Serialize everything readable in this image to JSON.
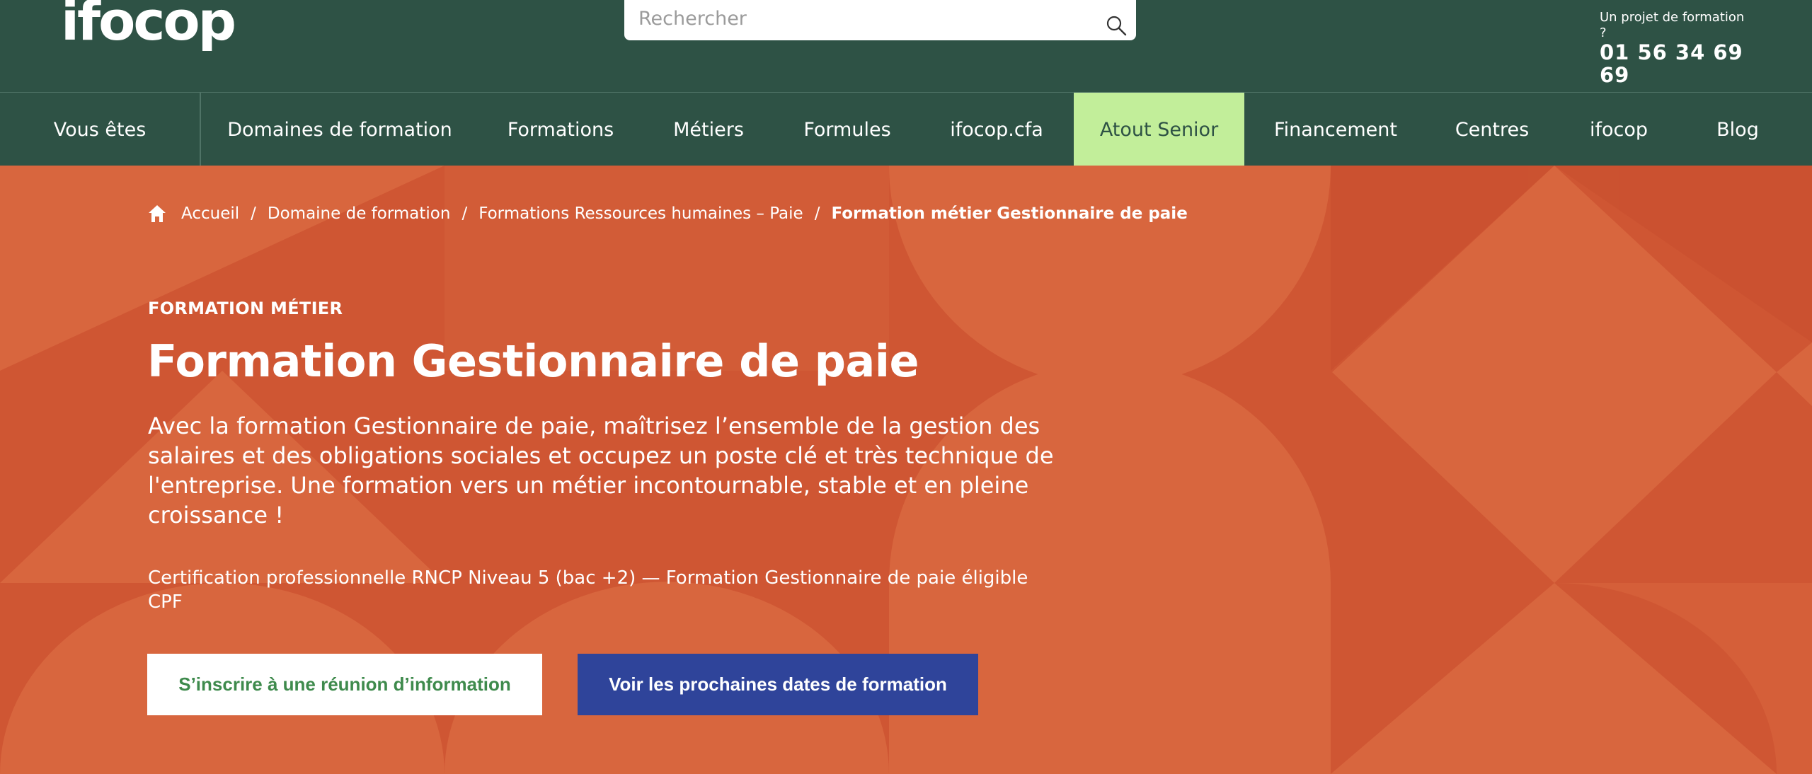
{
  "header": {
    "logo_text": "ifocop",
    "search_placeholder": "Rechercher",
    "contact_label": "Un projet de formation ?",
    "contact_phone": "01 56 34 69 69"
  },
  "nav": {
    "items": [
      {
        "label": "Vous êtes"
      },
      {
        "label": "Domaines de formation"
      },
      {
        "label": "Formations"
      },
      {
        "label": "Métiers"
      },
      {
        "label": "Formules"
      },
      {
        "label": "ifocop.cfa"
      },
      {
        "label": "Atout Senior"
      },
      {
        "label": "Financement"
      },
      {
        "label": "Centres"
      },
      {
        "label": "ifocop"
      },
      {
        "label": "Blog"
      }
    ]
  },
  "breadcrumb": {
    "items": [
      {
        "label": "Accueil"
      },
      {
        "label": "Domaine de formation"
      },
      {
        "label": "Formations Ressources humaines – Paie"
      },
      {
        "label": "Formation métier Gestionnaire de paie"
      }
    ],
    "separator": "/"
  },
  "hero": {
    "eyebrow": "FORMATION MÉTIER",
    "title": "Formation Gestionnaire de paie",
    "lead": "Avec la formation Gestionnaire de paie, maîtrisez l’ensemble de la gestion des salaires et des obligations sociales et occupez un poste clé et très technique de l'entreprise. Une formation vers un métier incontournable, stable et en pleine croissance !",
    "certification": "Certification professionnelle RNCP Niveau 5 (bac +2) — Formation Gestionnaire de paie éligible CPF",
    "button_info": "S’inscrire à une réunion d’information",
    "button_dates": "Voir les prochaines dates de formation"
  },
  "colors": {
    "header_bg": "#2e5245",
    "nav_highlight_bg": "#c2ee9a",
    "hero_bg": "#cf5633",
    "hero_shape": "#d8663e",
    "button_info_text": "#3e8a4c",
    "button_dates_bg": "#2f449a"
  }
}
